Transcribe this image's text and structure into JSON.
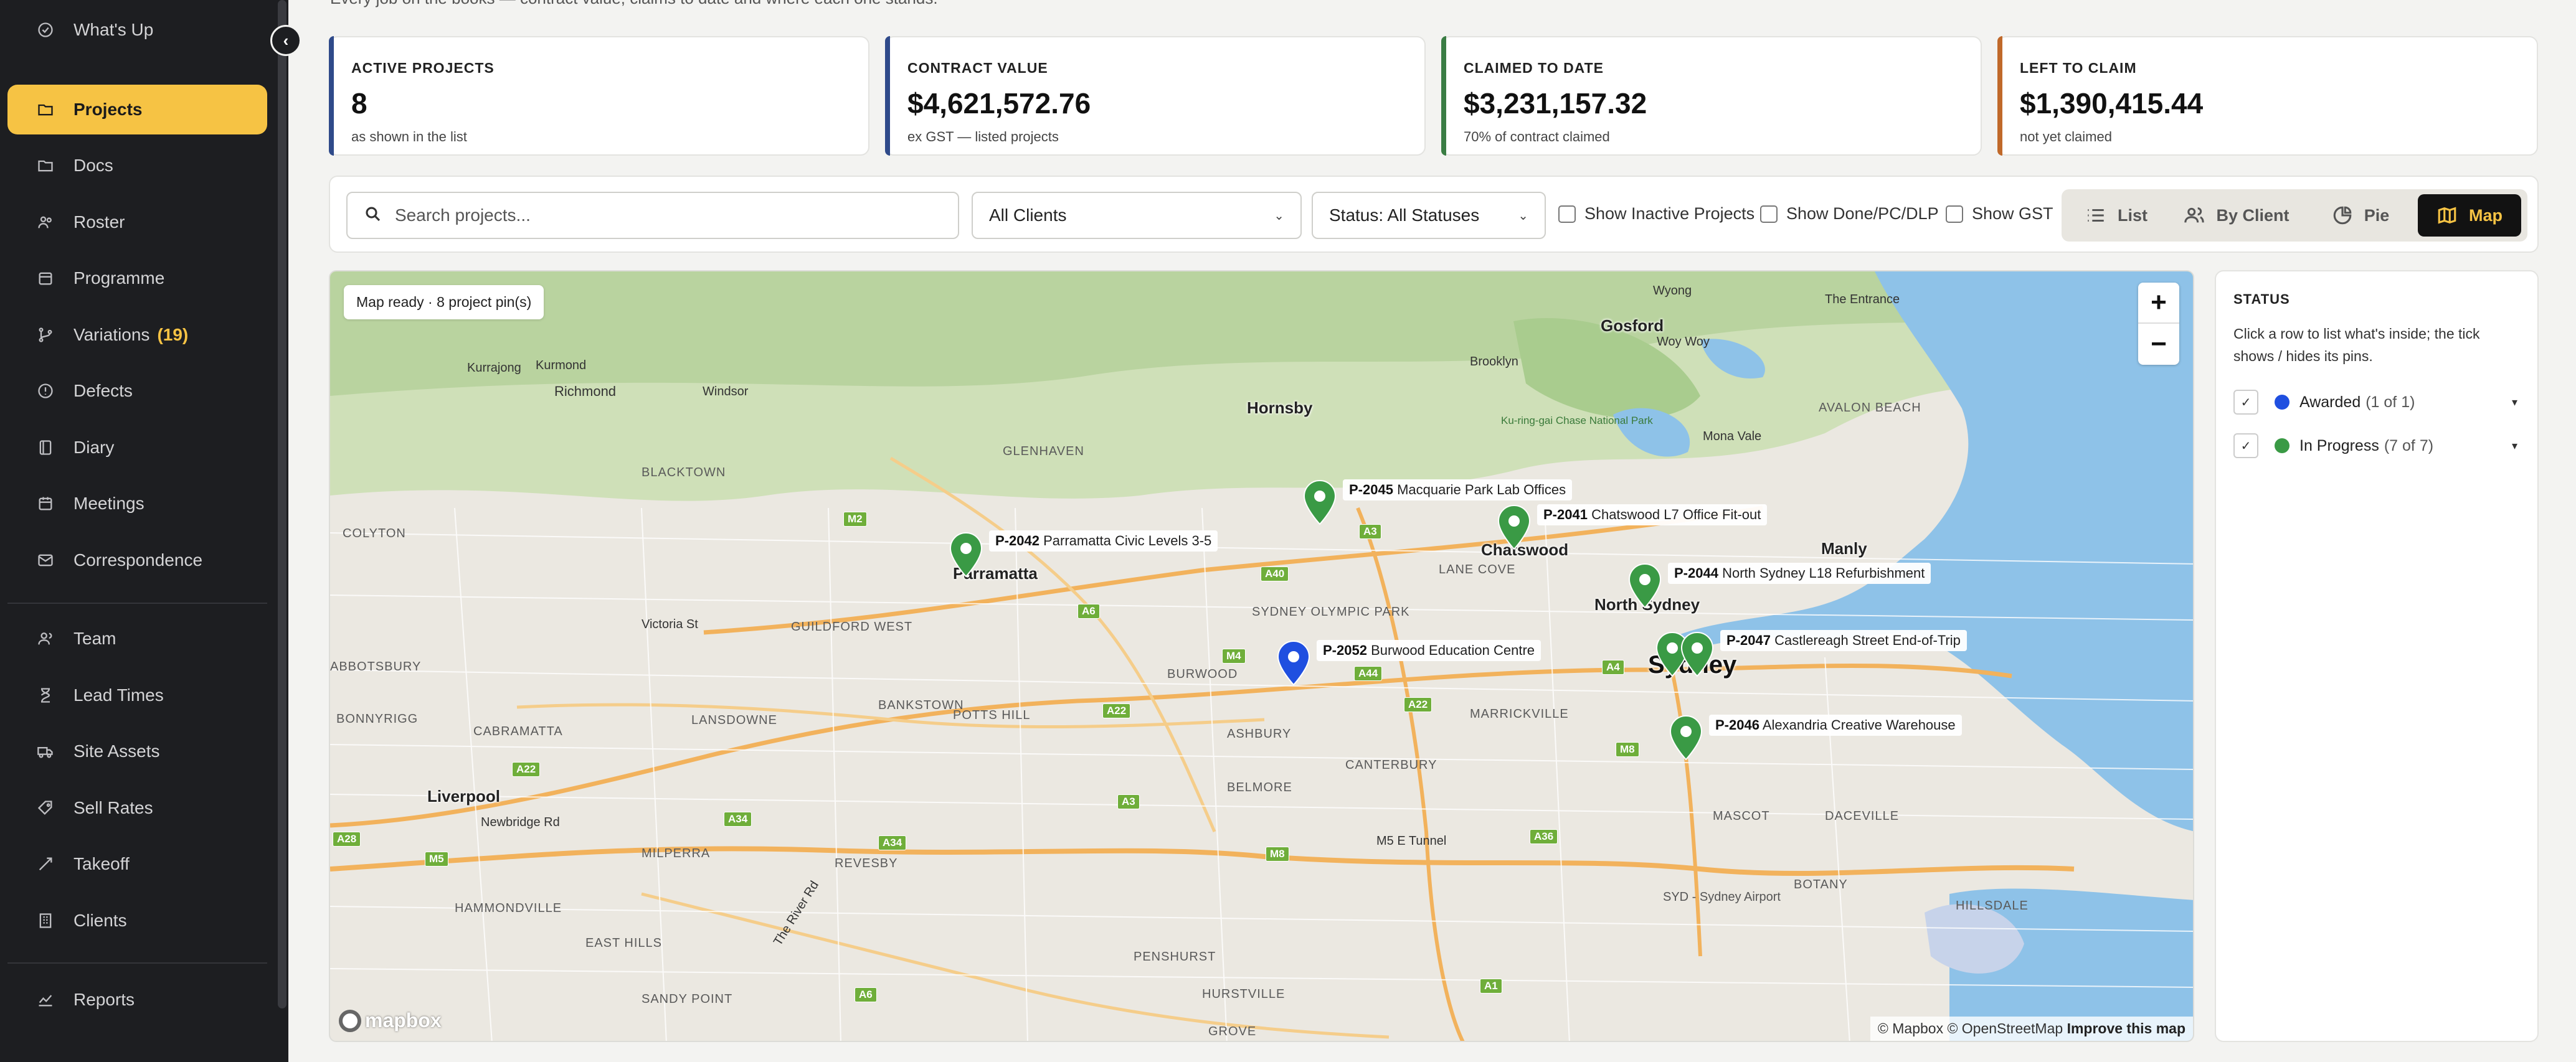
{
  "sidebar": {
    "items": [
      {
        "label": "What's Up",
        "icon": "activity-icon"
      },
      {
        "label": "Projects",
        "icon": "folder-icon",
        "active": true
      },
      {
        "label": "Docs",
        "icon": "folder-icon"
      },
      {
        "label": "Roster",
        "icon": "people-icon"
      },
      {
        "label": "Programme",
        "icon": "calendar-icon"
      },
      {
        "label": "Variations",
        "icon": "branch-icon",
        "count": "(19)"
      },
      {
        "label": "Defects",
        "icon": "alert-icon"
      },
      {
        "label": "Diary",
        "icon": "book-icon"
      },
      {
        "label": "Meetings",
        "icon": "calendar-icon"
      },
      {
        "label": "Correspondence",
        "icon": "mail-icon"
      },
      {
        "label": "Team",
        "icon": "user-icon"
      },
      {
        "label": "Lead Times",
        "icon": "hourglass-icon"
      },
      {
        "label": "Site Assets",
        "icon": "truck-icon"
      },
      {
        "label": "Sell Rates",
        "icon": "tag-icon"
      },
      {
        "label": "Takeoff",
        "icon": "ruler-icon"
      },
      {
        "label": "Clients",
        "icon": "building-icon"
      },
      {
        "label": "Reports",
        "icon": "chart-icon"
      }
    ]
  },
  "header": {
    "subtitle": "Every job on the books — contract value, claims to date and where each one stands."
  },
  "stats": [
    {
      "label": "ACTIVE PROJECTS",
      "value": "8",
      "sub": "as shown in the list",
      "color": "#2f4a8a"
    },
    {
      "label": "CONTRACT VALUE",
      "value": "$4,621,572.76",
      "sub": "ex GST — listed projects",
      "color": "#2f4a8a"
    },
    {
      "label": "CLAIMED TO DATE",
      "value": "$3,231,157.32",
      "sub": "70% of contract claimed",
      "color": "#3a7d44"
    },
    {
      "label": "LEFT TO CLAIM",
      "value": "$1,390,415.44",
      "sub": "not yet claimed",
      "color": "#c0692a"
    }
  ],
  "toolbar": {
    "search_placeholder": "Search projects...",
    "client_filter": "All Clients",
    "status_filter": "Status: All Statuses",
    "show_inactive": "Show Inactive Projects",
    "show_done": "Show Done/PC/DLP",
    "show_gst": "Show GST",
    "views": [
      {
        "label": "List",
        "icon": "list-icon"
      },
      {
        "label": "By Client",
        "icon": "people-icon"
      },
      {
        "label": "Pie",
        "icon": "pie-icon"
      },
      {
        "label": "Map",
        "icon": "map-icon",
        "active": true
      }
    ]
  },
  "map": {
    "status_text": "Map ready · 8 project pin(s)",
    "zoom_in": "+",
    "zoom_out": "−",
    "logo": "mapbox",
    "attribution": "© Mapbox © OpenStreetMap",
    "improve": "Improve this map",
    "pins": [
      {
        "id": "P-2045",
        "name": "Macquarie Park Lab Offices",
        "color": "#3a9a45"
      },
      {
        "id": "P-2041",
        "name": "Chatswood L7 Office Fit-out",
        "color": "#3a9a45"
      },
      {
        "id": "P-2042",
        "name": "Parramatta Civic Levels 3-5",
        "color": "#3a9a45"
      },
      {
        "id": "P-2044",
        "name": "North Sydney L18 Refurbishment",
        "color": "#3a9a45"
      },
      {
        "id": "P-2047",
        "name": "Castlereagh Street End-of-Trip",
        "color": "#3a9a45"
      },
      {
        "id": "P-2052",
        "name": "Burwood Education Centre",
        "color": "#1f4fe0"
      },
      {
        "id": "P-2046",
        "name": "Alexandria Creative Warehouse",
        "color": "#3a9a45"
      }
    ],
    "places": {
      "parramatta": "Parramatta",
      "chatswood": "Chatswood",
      "north_sydney": "North Sydney",
      "sydney": "Sydney",
      "manly": "Manly",
      "hornsby": "Hornsby",
      "gosford": "Gosford",
      "richmond": "Richmond",
      "windsor": "Windsor",
      "liverpool": "Liverpool",
      "burwood": "BURWOOD",
      "canterbury": "CANTERBURY",
      "marrickville": "MARRICKVILLE",
      "botany": "BOTANY",
      "hurstville": "HURSTVILLE",
      "revesby": "REVESBY",
      "bankstown": "BANKSTOWN",
      "potts_hill": "POTTS HILL",
      "blacktown": "BLACKTOWN",
      "mascot": "MASCOT",
      "penshurst": "PENSHURST",
      "belmore": "BELMORE",
      "airport": "SYD - Sydney Airport",
      "kurmond": "Kurmond",
      "kurrajong": "Kurrajong",
      "glenhaven": "GLENHAVEN",
      "victoria_st": "Victoria St",
      "newbridge": "Newbridge Rd",
      "cabramatta": "CABRAMATTA",
      "lansdowne": "LANSDOWNE",
      "milperra": "MILPERRA",
      "east_hills": "EAST HILLS",
      "hammondville": "HAMMONDVILLE",
      "bonnyrigg": "BONNYRIGG",
      "abbotsbury": "ABBOTSBURY",
      "colyton": "COLYTON",
      "sandy_point": "SANDY POINT",
      "guildford": "GUILDFORD WEST",
      "m5_tunnel": "M5 E Tunnel",
      "river_rd": "The River Rd",
      "dacevile": "DACEVILLE",
      "hillsdale": "HILLSDALE",
      "ashbury": "ASHBURY",
      "sydney_olympic": "SYDNEY OLYMPIC PARK",
      "lane_cove": "LANE COVE",
      "ku_ring_gai": "Ku-ring-gai Chase National Park",
      "wyong": "Wyong",
      "the_entrance": "The Entrance",
      "avalon": "AVALON BEACH",
      "mona_vale": "Mona Vale",
      "brooklyn": "Brooklyn",
      "woy_woy": "Woy Woy",
      "grove": "GROVE"
    }
  },
  "status_panel": {
    "title": "STATUS",
    "description": "Click a row to list what's inside; the tick shows / hides its pins.",
    "rows": [
      {
        "label": "Awarded",
        "count": "(1 of 1)",
        "color": "#1f4fe0"
      },
      {
        "label": "In Progress",
        "count": "(7 of 7)",
        "color": "#3a9a45"
      }
    ]
  }
}
